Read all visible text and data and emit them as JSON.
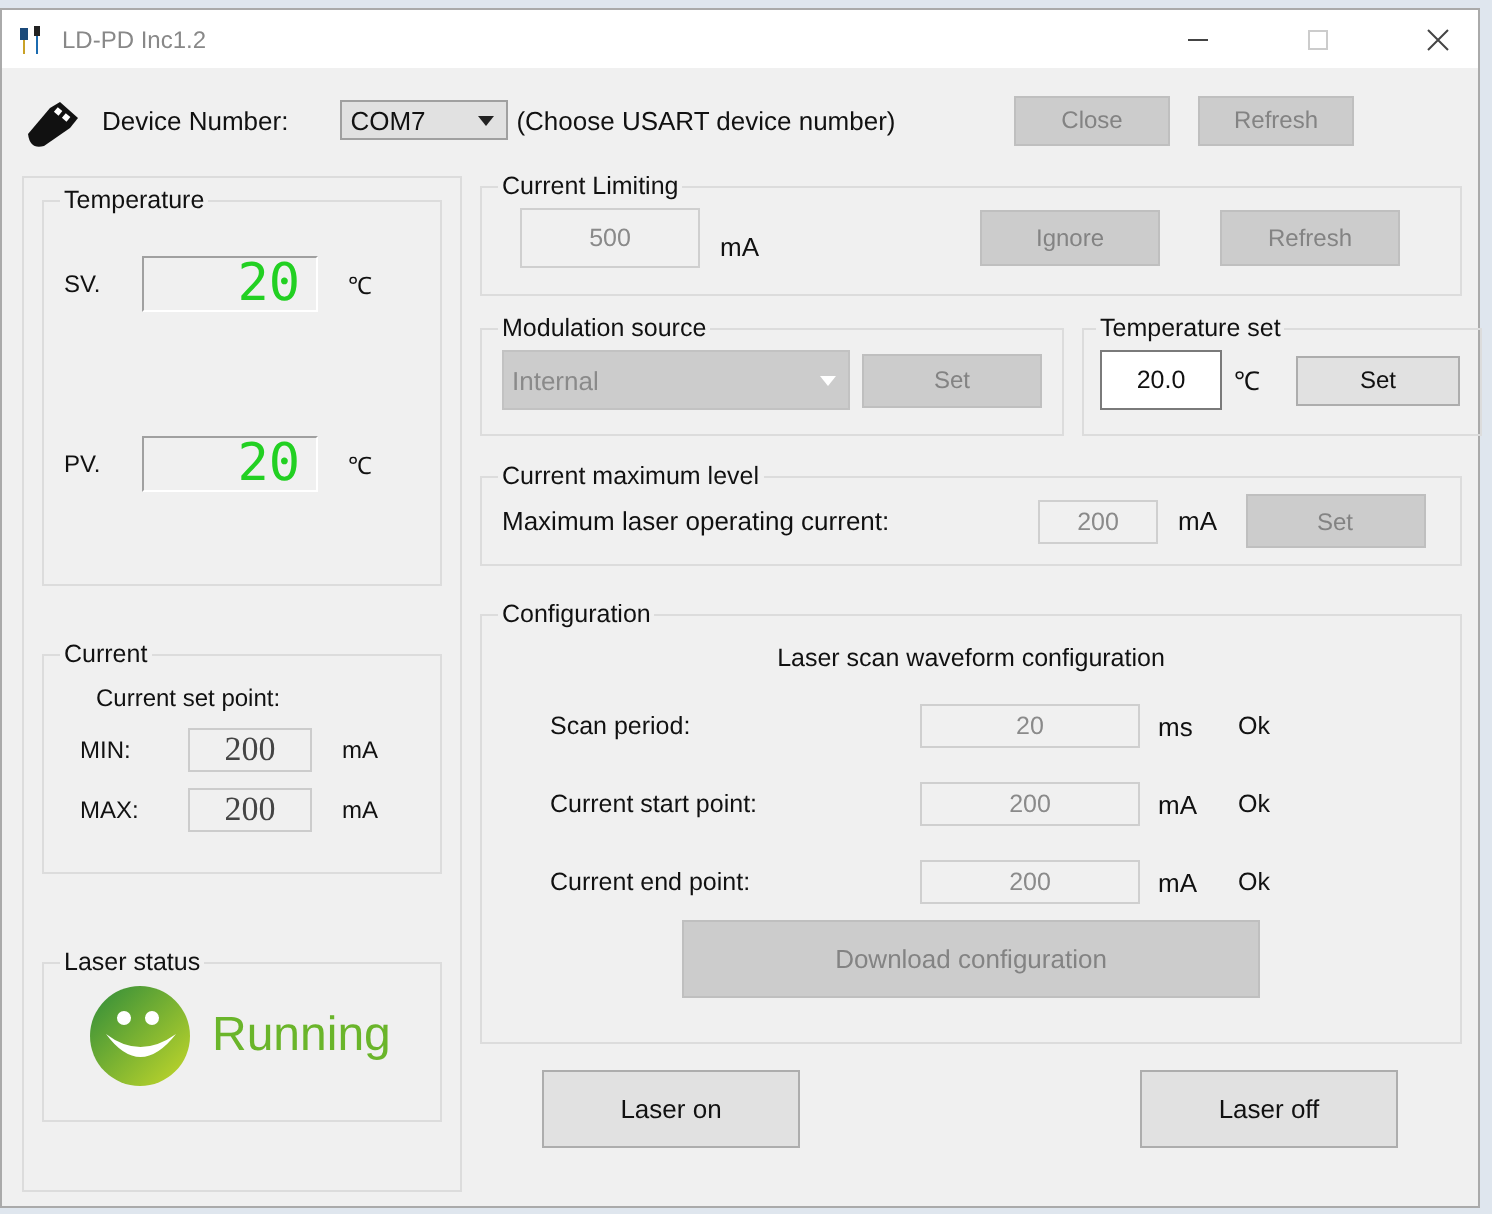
{
  "window": {
    "title": "LD-PD Inc1.2"
  },
  "device": {
    "label": "Device Number:",
    "port": "COM7",
    "hint": "(Choose USART device number)",
    "buttons": [
      {
        "label": "Close",
        "disabled": true
      },
      {
        "label": "Refresh",
        "disabled": true
      }
    ]
  },
  "temperature": {
    "title": "Temperature",
    "readings": [
      {
        "label": "SV.",
        "value": "20",
        "unit": "℃"
      },
      {
        "label": "PV.",
        "value": "20",
        "unit": "℃"
      }
    ]
  },
  "current": {
    "title": "Current",
    "caption": "Current set point:",
    "rows": [
      {
        "label": "MIN:",
        "value": "200",
        "unit": "mA"
      },
      {
        "label": "MAX:",
        "value": "200",
        "unit": "mA"
      }
    ]
  },
  "laser_status": {
    "title": "Laser status",
    "state": "Running"
  },
  "current_limiting": {
    "title": "Current Limiting",
    "value": "500",
    "disabled": true,
    "unit": "mA",
    "buttons": [
      {
        "label": "Ignore",
        "disabled": true
      },
      {
        "label": "Refresh",
        "disabled": true
      }
    ]
  },
  "modulation_source": {
    "title": "Modulation source",
    "value": "Internal",
    "disabled": true,
    "button": {
      "label": "Set",
      "disabled": true
    }
  },
  "temperature_set": {
    "title": "Temperature set",
    "value": "20.0",
    "disabled": false,
    "unit": "℃",
    "button": {
      "label": "Set",
      "disabled": false
    }
  },
  "current_max": {
    "title": "Current maximum level",
    "label": "Maximum laser operating current:",
    "value": "200",
    "disabled": true,
    "unit": "mA",
    "button": {
      "label": "Set",
      "disabled": true
    }
  },
  "configuration": {
    "title": "Configuration",
    "heading": "Laser scan waveform configuration",
    "rows": [
      {
        "label": "Scan period:",
        "value": "20",
        "disabled": true,
        "unit": "ms",
        "status": "Ok"
      },
      {
        "label": "Current start point:",
        "value": "200",
        "disabled": true,
        "unit": "mA",
        "status": "Ok"
      },
      {
        "label": "Current end point:",
        "value": "200",
        "disabled": true,
        "unit": "mA",
        "status": "Ok"
      }
    ],
    "button": {
      "label": "Download configuration",
      "disabled": true
    }
  },
  "actions": [
    {
      "label": "Laser on",
      "disabled": false
    },
    {
      "label": "Laser off",
      "disabled": false
    }
  ]
}
